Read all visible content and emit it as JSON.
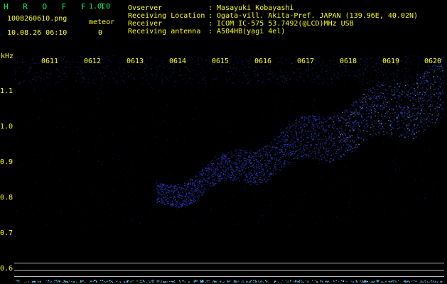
{
  "header": {
    "app_name": "H R O F F T",
    "version": "1.0.0",
    "filename": "1008260610.png",
    "datetime": "10.08.26 06:10",
    "meteor_label": "meteor",
    "meteor_count": "0"
  },
  "info": [
    {
      "label": "Ovserver",
      "value": ": Masayuki Kobayashi"
    },
    {
      "label": "Receiving Location",
      "value": ": Ogata-vill. Akita-Pref. JAPAN (139.96E, 40.02N)"
    },
    {
      "label": "Receiver",
      "value": ": ICOM IC-575 53.7492(@LCD)MHz USB"
    },
    {
      "label": "Receiving antenna",
      "value": ": A504HB(yagi 4el)"
    }
  ],
  "spectrogram": {
    "y_unit": "kHz",
    "y_ticks": [
      "1.1",
      "1.0",
      "0.9",
      "0.8",
      "0.7",
      "0.6"
    ],
    "x_ticks": [
      "0611",
      "0612",
      "0613",
      "0614",
      "0615",
      "0616",
      "0617",
      "0618",
      "0619",
      "0620"
    ]
  },
  "colors": {
    "background": "#000000",
    "label_text": "#ffff00",
    "title_text": "#00ff66",
    "signal": "#3a50ff"
  }
}
